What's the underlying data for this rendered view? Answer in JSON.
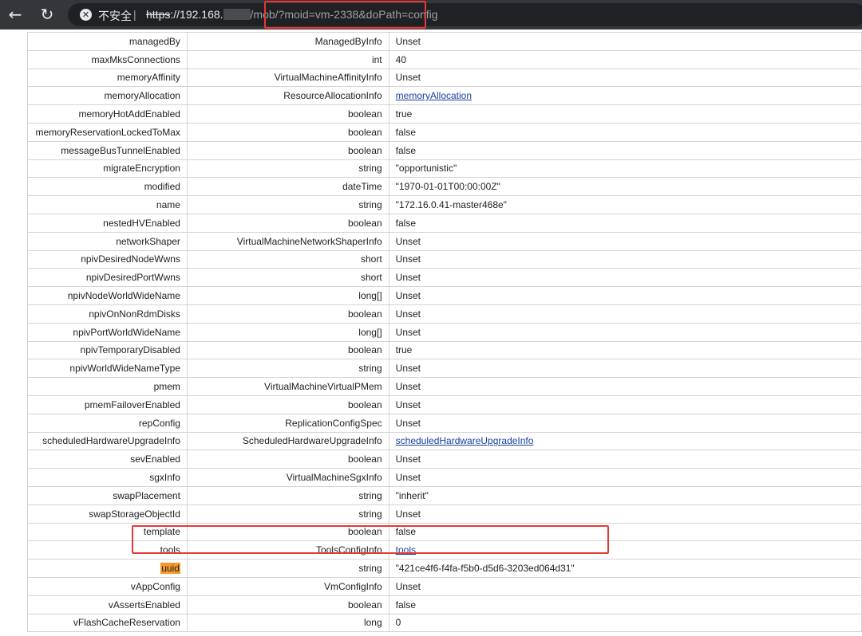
{
  "browser": {
    "back_icon": "arrow-left-icon",
    "reload_icon": "reload-icon",
    "insecure_label": "不安全",
    "separator": "|",
    "url_scheme": "https",
    "url_host_visible": "://192.168.",
    "url_path_part": "/mob",
    "url_query": "/?moid=vm-2338&doPath=config"
  },
  "table": {
    "rows": [
      {
        "name": "managedBy",
        "type": "ManagedByInfo",
        "value": "Unset",
        "link": false
      },
      {
        "name": "maxMksConnections",
        "type": "int",
        "value": "40",
        "link": false
      },
      {
        "name": "memoryAffinity",
        "type": "VirtualMachineAffinityInfo",
        "value": "Unset",
        "link": false
      },
      {
        "name": "memoryAllocation",
        "type": "ResourceAllocationInfo",
        "value": "memoryAllocation",
        "link": true
      },
      {
        "name": "memoryHotAddEnabled",
        "type": "boolean",
        "value": "true",
        "link": false
      },
      {
        "name": "memoryReservationLockedToMax",
        "type": "boolean",
        "value": "false",
        "link": false
      },
      {
        "name": "messageBusTunnelEnabled",
        "type": "boolean",
        "value": "false",
        "link": false
      },
      {
        "name": "migrateEncryption",
        "type": "string",
        "value": "\"opportunistic\"",
        "link": false
      },
      {
        "name": "modified",
        "type": "dateTime",
        "value": "\"1970-01-01T00:00:00Z\"",
        "link": false
      },
      {
        "name": "name",
        "type": "string",
        "value": "\"172.16.0.41-master468e\"",
        "link": false
      },
      {
        "name": "nestedHVEnabled",
        "type": "boolean",
        "value": "false",
        "link": false
      },
      {
        "name": "networkShaper",
        "type": "VirtualMachineNetworkShaperInfo",
        "value": "Unset",
        "link": false
      },
      {
        "name": "npivDesiredNodeWwns",
        "type": "short",
        "value": "Unset",
        "link": false
      },
      {
        "name": "npivDesiredPortWwns",
        "type": "short",
        "value": "Unset",
        "link": false
      },
      {
        "name": "npivNodeWorldWideName",
        "type": "long[]",
        "value": "Unset",
        "link": false
      },
      {
        "name": "npivOnNonRdmDisks",
        "type": "boolean",
        "value": "Unset",
        "link": false
      },
      {
        "name": "npivPortWorldWideName",
        "type": "long[]",
        "value": "Unset",
        "link": false
      },
      {
        "name": "npivTemporaryDisabled",
        "type": "boolean",
        "value": "true",
        "link": false
      },
      {
        "name": "npivWorldWideNameType",
        "type": "string",
        "value": "Unset",
        "link": false
      },
      {
        "name": "pmem",
        "type": "VirtualMachineVirtualPMem",
        "value": "Unset",
        "link": false
      },
      {
        "name": "pmemFailoverEnabled",
        "type": "boolean",
        "value": "Unset",
        "link": false
      },
      {
        "name": "repConfig",
        "type": "ReplicationConfigSpec",
        "value": "Unset",
        "link": false
      },
      {
        "name": "scheduledHardwareUpgradeInfo",
        "type": "ScheduledHardwareUpgradeInfo",
        "value": "scheduledHardwareUpgradeInfo",
        "link": true
      },
      {
        "name": "sevEnabled",
        "type": "boolean",
        "value": "Unset",
        "link": false
      },
      {
        "name": "sgxInfo",
        "type": "VirtualMachineSgxInfo",
        "value": "Unset",
        "link": false
      },
      {
        "name": "swapPlacement",
        "type": "string",
        "value": "\"inherit\"",
        "link": false
      },
      {
        "name": "swapStorageObjectId",
        "type": "string",
        "value": "Unset",
        "link": false
      },
      {
        "name": "template",
        "type": "boolean",
        "value": "false",
        "link": false
      },
      {
        "name": "tools",
        "type": "ToolsConfigInfo",
        "value": "tools",
        "link": true
      },
      {
        "name": "uuid",
        "type": "string",
        "value": "\"421ce4f6-f4fa-f5b0-d5d6-3203ed064d31\"",
        "link": false,
        "highlight": true
      },
      {
        "name": "vAppConfig",
        "type": "VmConfigInfo",
        "value": "Unset",
        "link": false
      },
      {
        "name": "vAssertsEnabled",
        "type": "boolean",
        "value": "false",
        "link": false
      },
      {
        "name": "vFlashCacheReservation",
        "type": "long",
        "value": "0",
        "link": false
      }
    ]
  },
  "colors": {
    "toolbar": "#35363a",
    "omnibox": "#202124",
    "annotation_red": "#e53935",
    "search_highlight": "#f39a2b",
    "link": "#1a3ea0"
  }
}
